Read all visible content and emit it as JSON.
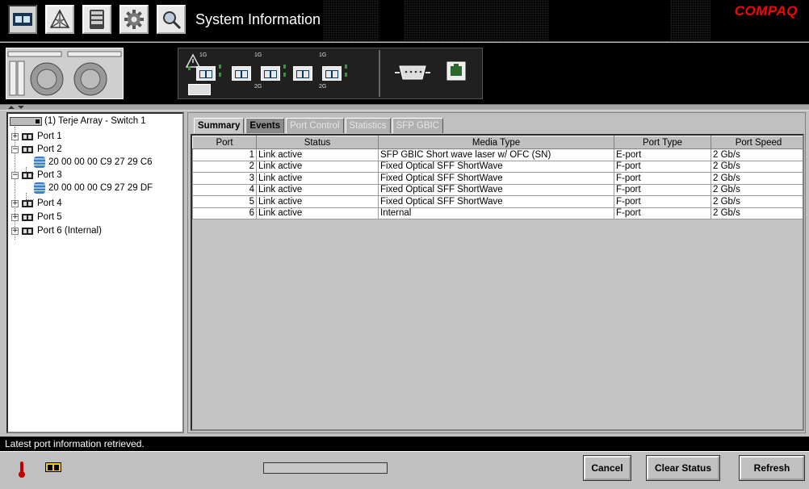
{
  "header": {
    "title": "System Information",
    "brand": "COMPAQ",
    "toolbar": [
      "switch-view",
      "fabric-topology",
      "storage",
      "settings",
      "search"
    ]
  },
  "tree": {
    "root": "(1) Terje Array - Switch 1",
    "items": [
      {
        "label": "Port 1",
        "expanded": false
      },
      {
        "label": "Port 2",
        "expanded": true,
        "children": [
          "20 00 00 00 C9 27 29 C6"
        ]
      },
      {
        "label": "Port 3",
        "expanded": true,
        "children": [
          "20 00 00 00 C9 27 29 DF"
        ]
      },
      {
        "label": "Port 4",
        "expanded": false
      },
      {
        "label": "Port 5",
        "expanded": false
      },
      {
        "label": "Port 6 (Internal)",
        "expanded": false
      }
    ]
  },
  "tabs": [
    {
      "label": "Summary",
      "state": "selected"
    },
    {
      "label": "Events",
      "state": "enabled"
    },
    {
      "label": "Port Control",
      "state": "disabled"
    },
    {
      "label": "Statistics",
      "state": "disabled"
    },
    {
      "label": "SFP GBIC",
      "state": "disabled"
    }
  ],
  "table": {
    "columns": [
      "Port",
      "Status",
      "Media Type",
      "Port Type",
      "Port Speed"
    ],
    "rows": [
      [
        "1",
        "Link active",
        "SFP GBIC Short wave laser w/ OFC (SN)",
        "E-port",
        "2 Gb/s"
      ],
      [
        "2",
        "Link active",
        "Fixed Optical SFF ShortWave",
        "F-port",
        "2 Gb/s"
      ],
      [
        "3",
        "Link active",
        "Fixed Optical SFF ShortWave",
        "F-port",
        "2 Gb/s"
      ],
      [
        "4",
        "Link active",
        "Fixed Optical SFF ShortWave",
        "F-port",
        "2 Gb/s"
      ],
      [
        "5",
        "Link active",
        "Fixed Optical SFF ShortWave",
        "F-port",
        "2 Gb/s"
      ],
      [
        "6",
        "Link active",
        "Internal",
        "F-port",
        "2 Gb/s"
      ]
    ]
  },
  "status": {
    "message": "Latest port information retrieved."
  },
  "buttons": {
    "cancel": "Cancel",
    "clear_status": "Clear Status",
    "refresh": "Refresh"
  },
  "device": {
    "port_label_1g": "1G",
    "port_label_2g": "2G"
  },
  "colors": {
    "brand": "#ff0000",
    "header_bg": "#000000",
    "panel_bg": "#c0c0c0",
    "led_green": "#2ea02e"
  }
}
